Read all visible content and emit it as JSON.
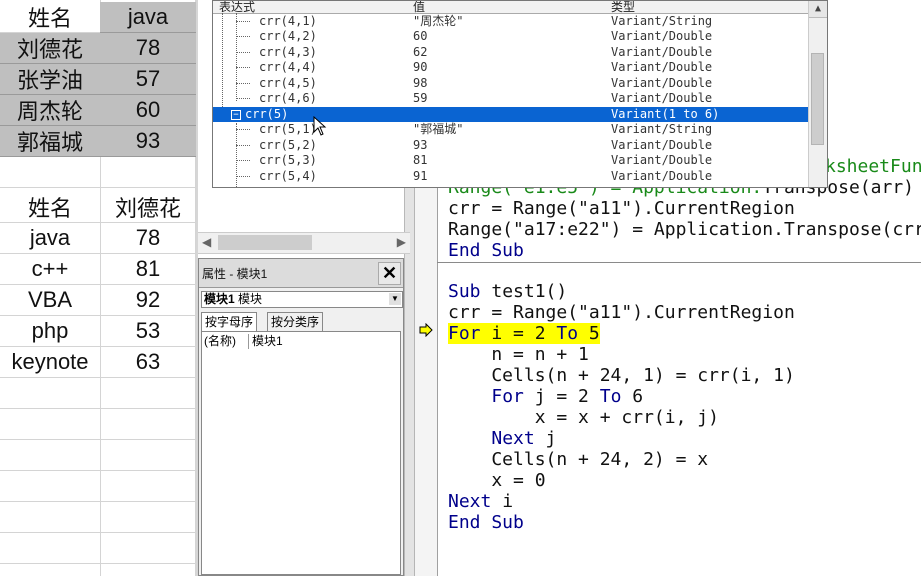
{
  "sheet": {
    "table1": {
      "header": [
        "姓名",
        "java"
      ],
      "rows": [
        [
          "刘德花",
          "78"
        ],
        [
          "张学油",
          "57"
        ],
        [
          "周杰轮",
          "60"
        ],
        [
          "郭福城",
          "93"
        ]
      ]
    },
    "table2": {
      "header": [
        "姓名",
        "刘德花"
      ],
      "rows": [
        [
          "java",
          "78"
        ],
        [
          "c++",
          "81"
        ],
        [
          "VBA",
          "92"
        ],
        [
          "php",
          "53"
        ],
        [
          "keynote",
          "63"
        ]
      ]
    }
  },
  "watch": {
    "columns": [
      "表达式",
      "值",
      "类型"
    ],
    "rows": [
      {
        "expr": "crr(4,1)",
        "value": "\"周杰轮\"",
        "type": "Variant/String"
      },
      {
        "expr": "crr(4,2)",
        "value": "60",
        "type": "Variant/Double"
      },
      {
        "expr": "crr(4,3)",
        "value": "62",
        "type": "Variant/Double"
      },
      {
        "expr": "crr(4,4)",
        "value": "90",
        "type": "Variant/Double"
      },
      {
        "expr": "crr(4,5)",
        "value": "98",
        "type": "Variant/Double"
      },
      {
        "expr": "crr(4,6)",
        "value": "59",
        "type": "Variant/Double"
      },
      {
        "expr": "crr(5)",
        "value": "",
        "type": "Variant(1 to 6)",
        "selected": true
      },
      {
        "expr": "crr(5,1)",
        "value": "\"郭福城\"",
        "type": "Variant/String"
      },
      {
        "expr": "crr(5,2)",
        "value": "93",
        "type": "Variant/Double"
      },
      {
        "expr": "crr(5,3)",
        "value": "81",
        "type": "Variant/Double"
      },
      {
        "expr": "crr(5,4)",
        "value": "91",
        "type": "Variant/Double"
      }
    ]
  },
  "properties": {
    "title": "属性 - 模块1",
    "close_label": "✕",
    "object_name": "模块1",
    "object_type": "模块",
    "tabs": [
      "按字母序",
      "按分类序"
    ],
    "prop_name": "(名称)",
    "prop_value": "模块1"
  },
  "code": {
    "top_partial": {
      "l1": "ksheetFun",
      "l2a": "Range(\"e1:e5\") = Application.",
      "l2b": "Transpose(arr)"
    },
    "lines_block1": [
      "crr = Range(\"a11\").CurrentRegion",
      "Range(\"a17:e22\") = Application.Transpose(crr)"
    ],
    "end_sub": "End Sub",
    "sub_test1": {
      "kw": "Sub",
      "name": " test1()"
    },
    "line_crr": "crr = Range(\"a11\").CurrentRegion",
    "for_i": {
      "for": "For",
      "mid": " i = 2 ",
      "to": "To",
      "end": " 5"
    },
    "line_n": "    n = n + 1",
    "line_cells1": "    Cells(n + 24, 1) = crr(i, 1)",
    "for_j": {
      "indent": "    ",
      "for": "For",
      "mid": " j = 2 ",
      "to": "To",
      "end": " 6"
    },
    "line_x": "        x = x + crr(i, j)",
    "next_j": {
      "indent": "    ",
      "kw": "Next",
      "rest": " j"
    },
    "line_cells2": "    Cells(n + 24, 2) = x",
    "line_x0": "    x = 0",
    "next_i": {
      "kw": "Next",
      "rest": " i"
    },
    "end_sub2": "End Sub"
  },
  "colors": {
    "selection": "#0a64d2",
    "keyword": "#00008b",
    "comment": "#198a19",
    "highlight": "#ffff00"
  }
}
